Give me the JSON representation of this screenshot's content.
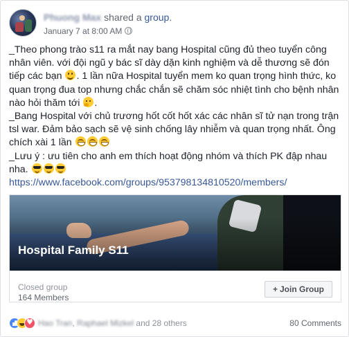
{
  "post": {
    "author": "Phuong Max",
    "verb": "shared a",
    "group_word": "group",
    "period": ".",
    "timestamp": "January 7 at 8:00 AM"
  },
  "body": {
    "para1_a": "_Theo phong trào s11 ra mắt nay bang Hospital cũng đủ theo tuyển công nhân viên. với đội ngũ y bác sĩ dày dặn kinh nghiệm và dễ thương sẽ đón tiếp các bạn",
    "para1_b": ". 1 lần nữa Hospital tuyển mem ko quan trọng hình thức, ko quan trọng đua top nhưng chắc chắn sẽ chăm sóc nhiệt tình cho bệnh nhân nào hỏi thăm tới",
    "para1_c": ".",
    "para2": "_Bang Hospital với chủ trương hốt cốt hốt xác các nhân sĩ tử nạn trong trận tsl war. Đảm bảo sạch sẽ vệ sinh chống lây nhiễm và quan trọng nhất. Ông chích xài 1 lần",
    "para3": "_Lưu ý : ưu tiên cho anh em thích hoạt động nhóm và thích PK đập nhau nha.",
    "url": "https://www.facebook.com/groups/953798134810520/members/"
  },
  "preview": {
    "title": "Hospital Family S11"
  },
  "group_card": {
    "type": "Closed group",
    "members": "164 Members",
    "join_label": "Join Group",
    "join_icon": "+"
  },
  "reactions": {
    "name1": "Hao Tran",
    "name2": "Raphael Mizkel",
    "others": "and 28 others",
    "comments": "80 Comments",
    "colors": {
      "like": "#4a86f7",
      "haha": "#ffcc33",
      "love": "#f25268"
    }
  },
  "icons": [
    "globe-icon",
    "smile-emoji",
    "thinking-emoji",
    "grin-emoji",
    "sunglasses-emoji",
    "like-reaction-icon",
    "haha-reaction-icon",
    "love-reaction-icon",
    "plus-icon"
  ]
}
